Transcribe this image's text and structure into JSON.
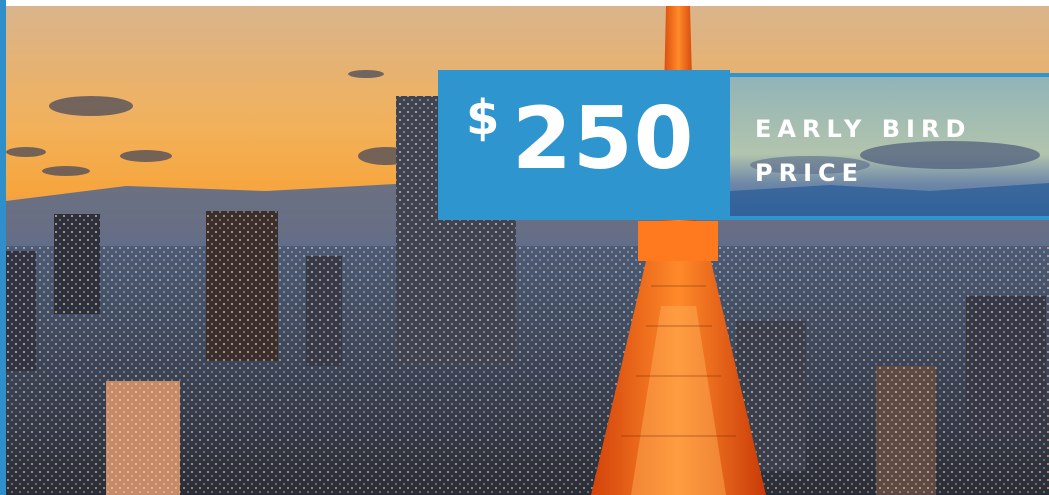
{
  "banner": {
    "currency": "$",
    "amount": "250",
    "label": "EARLY BIRD PRICE"
  },
  "colors": {
    "accent": "#2e95cf",
    "sky_top": "#c9a57a",
    "sky_glow": "#f5a83a",
    "tower": "#ff6a12"
  },
  "image": {
    "description_icon": "city-skyline-image"
  }
}
